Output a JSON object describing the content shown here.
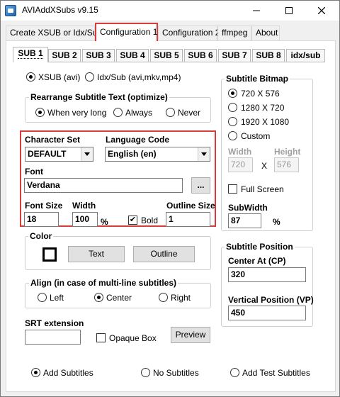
{
  "window": {
    "title": "AVIAddXSubs v9.15"
  },
  "tabs": [
    "Create XSUB or Idx/Sub",
    "Configuration 1",
    "Configuration 2",
    "ffmpeg",
    "About"
  ],
  "subtabs": [
    "SUB 1",
    "SUB 2",
    "SUB 3",
    "SUB 4",
    "SUB 5",
    "SUB 6",
    "SUB 7",
    "SUB 8",
    "idx/sub"
  ],
  "format": {
    "xsub": "XSUB (avi)",
    "idxsub": "Idx/Sub (avi,mkv,mp4)"
  },
  "rearrange": {
    "title": "Rearrange Subtitle Text (optimize)",
    "opt1": "When very long",
    "opt2": "Always",
    "opt3": "Never"
  },
  "font": {
    "charset_label": "Character Set",
    "charset_value": "DEFAULT",
    "language_label": "Language Code",
    "language_value": "English (en)",
    "font_label": "Font",
    "font_value": "Verdana",
    "browse_label": "...",
    "size_label": "Font Size",
    "size_value": "18",
    "width_label": "Width",
    "width_value": "100",
    "width_unit": "%",
    "bold_label": "Bold",
    "bold_mark": "✔",
    "outline_label": "Outline Size",
    "outline_value": "1"
  },
  "color": {
    "title": "Color",
    "text_btn": "Text",
    "outline_btn": "Outline"
  },
  "align": {
    "title": "Align (in case of multi-line subtitles)",
    "left": "Left",
    "center": "Center",
    "right": "Right"
  },
  "srt": {
    "label": "SRT extension",
    "value": "",
    "opaque_label": "Opaque Box",
    "preview_btn": "Preview"
  },
  "bitmap": {
    "title": "Subtitle Bitmap",
    "res1": "720 X 576",
    "res2": "1280 X 720",
    "res3": "1920 X 1080",
    "res4": "Custom",
    "width_label": "Width",
    "height_label": "Height",
    "width_value": "720",
    "x_label": "X",
    "height_value": "576",
    "fullscreen_label": "Full Screen",
    "subwidth_label": "SubWidth",
    "subwidth_value": "87",
    "subwidth_unit": "%"
  },
  "position": {
    "title": "Subtitle Position",
    "center_label": "Center At (CP)",
    "center_value": "320",
    "vertical_label": "Vertical Position (VP)",
    "vertical_value": "450"
  },
  "bottom": {
    "add": "Add Subtitles",
    "none": "No Subtitles",
    "test": "Add Test Subtitles"
  },
  "colors": {
    "highlight": "#d93a3a"
  }
}
